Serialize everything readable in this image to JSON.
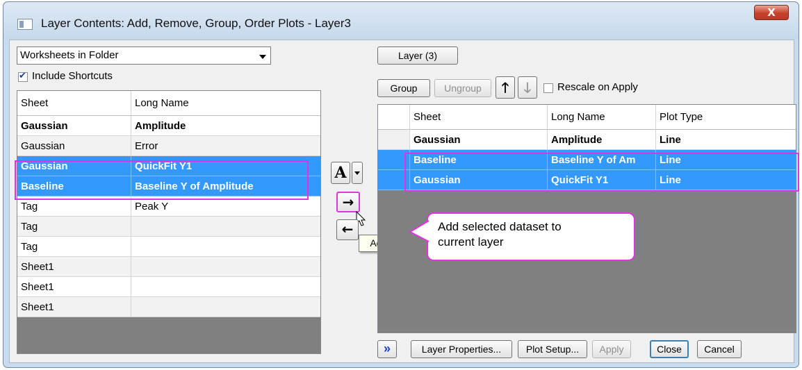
{
  "window": {
    "title": "Layer Contents: Add, Remove, Group, Order Plots - Layer3",
    "close_glyph": "X"
  },
  "left": {
    "source_select": "Worksheets in Folder",
    "include_shortcuts_label": "Include Shortcuts",
    "include_shortcuts_checked": true,
    "columns": [
      "Sheet",
      "Long Name"
    ],
    "rows": [
      {
        "sheet": "Gaussian",
        "long_name": "Amplitude",
        "style": "bold"
      },
      {
        "sheet": "Gaussian",
        "long_name": "Error",
        "style": "gray"
      },
      {
        "sheet": "Gaussian",
        "long_name": "QuickFit Y1",
        "style": "selected"
      },
      {
        "sheet": "Baseline",
        "long_name": "Baseline Y of Amplitude",
        "style": "selected"
      },
      {
        "sheet": "Tag",
        "long_name": "Peak Y",
        "style": "white"
      },
      {
        "sheet": "Tag",
        "long_name": "",
        "style": "gray"
      },
      {
        "sheet": "Tag",
        "long_name": "",
        "style": "white"
      },
      {
        "sheet": "Sheet1",
        "long_name": "",
        "style": "gray"
      },
      {
        "sheet": "Sheet1",
        "long_name": "",
        "style": "white"
      },
      {
        "sheet": "Sheet1",
        "long_name": "",
        "style": "gray"
      }
    ]
  },
  "middle": {
    "font_button_label": "A",
    "add_arrow": "→",
    "remove_arrow": "←",
    "tooltip": "Add plot"
  },
  "right": {
    "layer_button": "Layer (3)",
    "group_button": "Group",
    "ungroup_button": "Ungroup",
    "up_arrow": "🡑",
    "down_arrow": "🡓",
    "rescale_label": "Rescale on Apply",
    "rescale_checked": false,
    "columns": [
      "Sheet",
      "Long Name",
      "Plot Type"
    ],
    "rows": [
      {
        "sheet": "Gaussian",
        "long_name": "Amplitude",
        "plot_type": "Line",
        "style": "bold"
      },
      {
        "sheet": "Baseline",
        "long_name": "Baseline Y of Am",
        "plot_type": "Line",
        "style": "selected"
      },
      {
        "sheet": "Gaussian",
        "long_name": "QuickFit Y1",
        "plot_type": "Line",
        "style": "selected"
      }
    ]
  },
  "callout": {
    "line1": "Add selected dataset to",
    "line2": "current layer"
  },
  "footer": {
    "expand_glyph": "»",
    "layer_properties": "Layer Properties...",
    "plot_setup": "Plot Setup...",
    "apply": "Apply",
    "close": "Close",
    "cancel": "Cancel"
  },
  "colors": {
    "selection": "#3399ff",
    "highlight": "#e033e0",
    "grid_background": "#808080"
  }
}
